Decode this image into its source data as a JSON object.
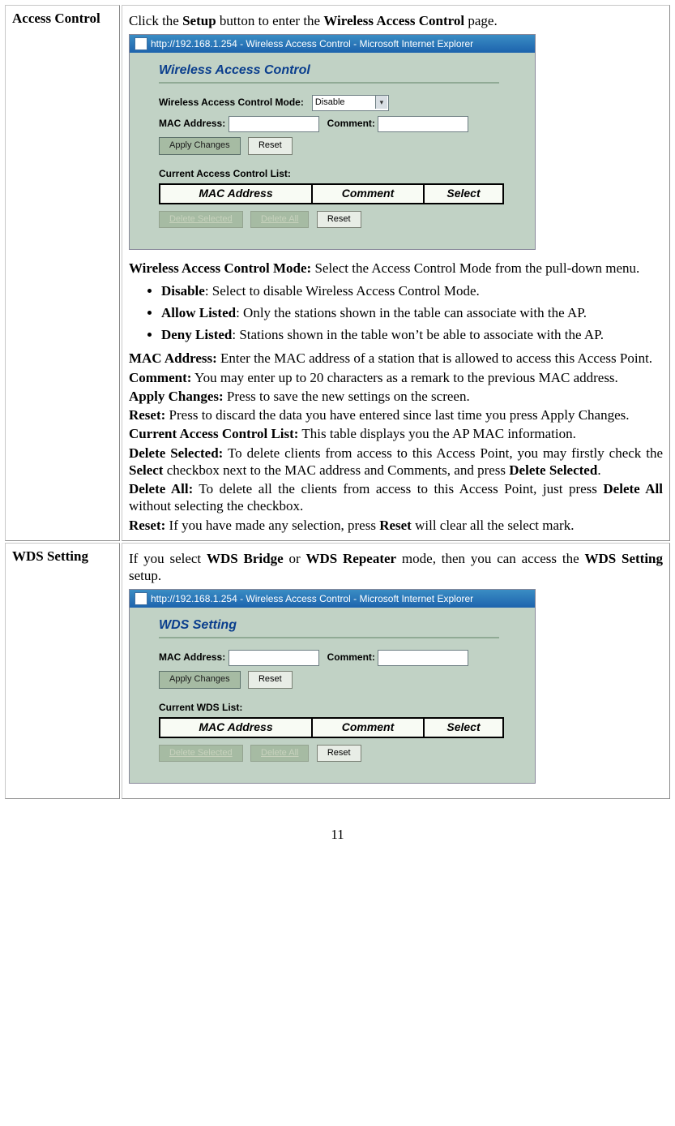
{
  "rows": {
    "0": {
      "label": "Access Control",
      "intro_prefix": "Click the ",
      "intro_b1": "Setup",
      "intro_mid": " button to enter the ",
      "intro_b2": "Wireless Access Control",
      "intro_suffix": " page.",
      "wacm_lead_b": "Wireless Access Control Mode:",
      "wacm_lead_t": " Select the Access Control Mode from the pull-down menu.",
      "li0_b": "Disable",
      "li0_t": ": Select to disable Wireless Access Control Mode.",
      "li1_b": "Allow Listed",
      "li1_t": ": Only the stations shown in the table can associate with the AP.",
      "li2_b": "Deny Listed",
      "li2_t": ": Stations shown in the table won’t be able to associate with the AP.",
      "mac_b": "MAC Address:",
      "mac_t": " Enter the MAC address of a station that is allowed to access this Access Point.",
      "com_b": "Comment:",
      "com_t": " You may enter up to 20 characters as a remark to the previous MAC address.",
      "apl_b": "Apply Changes:",
      "apl_t": " Press to save the new settings on the screen.",
      "rs1_b": "Reset:",
      "rs1_t": " Press to discard the data you have entered since last time you press Apply Changes.",
      "cur_b": "Current Access Control List:",
      "cur_t": " This table displays you the AP MAC information.",
      "ds_b": "Delete Selected:",
      "ds_t1": " To delete clients from access to this Access Point, you may firstly check the ",
      "ds_t2": "Select",
      "ds_t3": " checkbox next to the MAC address and Comments, and press ",
      "ds_t4": "Delete Selected",
      "ds_t5": ".",
      "da_b": "Delete All:",
      "da_t1": " To delete all the clients from access to this Access Point, just press ",
      "da_t2": "Delete All",
      "da_t3": " without selecting the checkbox.",
      "rs2_b": "Reset:",
      "rs2_t1": " If you have made any selection, press ",
      "rs2_t2": "Reset",
      "rs2_t3": " will clear all the select mark."
    },
    "1": {
      "label": "WDS Setting",
      "intro_prefix": "If you select ",
      "intro_b1": "WDS Bridge",
      "intro_mid": " or ",
      "intro_b2": "WDS Repeater",
      "intro_mid2": " mode, then you can access the ",
      "intro_b3": "WDS Setting",
      "intro_suffix": " setup."
    }
  },
  "shot1": {
    "title": "http://192.168.1.254 - Wireless Access Control - Microsoft Internet Explorer",
    "heading": "Wireless Access Control",
    "mode_label": "Wireless Access Control Mode:",
    "mode_value": "Disable",
    "mac_label": "MAC Address:",
    "comment_label": "Comment:",
    "apply_btn": "Apply Changes",
    "reset_btn": "Reset",
    "list_label": "Current Access Control List:",
    "th_mac": "MAC Address",
    "th_comment": "Comment",
    "th_select": "Select",
    "del_sel_btn": "Delete Selected",
    "del_all_btn": "Delete All",
    "reset2_btn": "Reset"
  },
  "shot2": {
    "title": "http://192.168.1.254 - Wireless Access Control - Microsoft Internet Explorer",
    "heading": "WDS Setting",
    "mac_label": "MAC Address:",
    "comment_label": "Comment:",
    "apply_btn": "Apply Changes",
    "reset_btn": "Reset",
    "list_label": "Current WDS List:",
    "th_mac": "MAC Address",
    "th_comment": "Comment",
    "th_select": "Select",
    "del_sel_btn": "Delete Selected",
    "del_all_btn": "Delete All",
    "reset2_btn": "Reset"
  },
  "pagenum": "11"
}
